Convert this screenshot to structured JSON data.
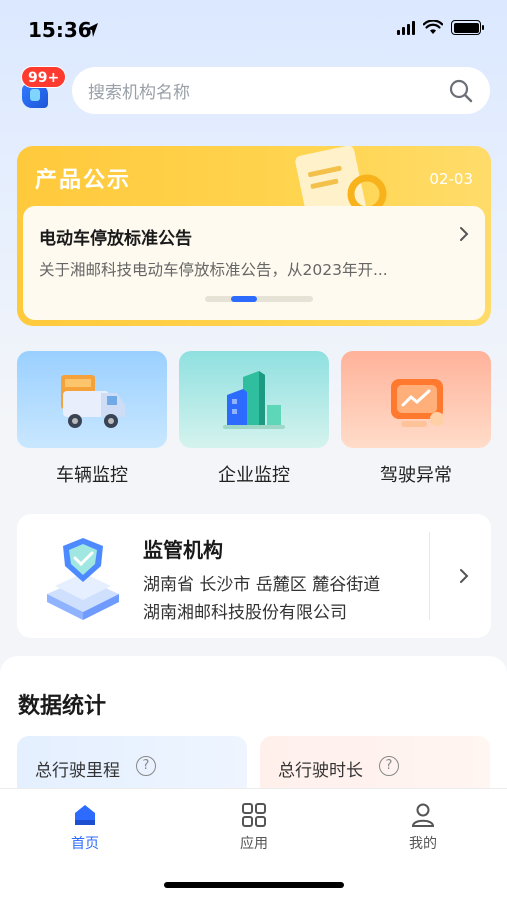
{
  "status_bar": {
    "time": "15:36"
  },
  "header": {
    "badge": "99+",
    "search_placeholder": "搜索机构名称"
  },
  "notice": {
    "title": "产品公示",
    "date": "02-03",
    "item_title": "电动车停放标准公告",
    "item_desc": "关于湘邮科技电动车停放标准公告，从2023年开..."
  },
  "tiles": [
    {
      "label": "车辆监控",
      "icon": "truck-icon"
    },
    {
      "label": "企业监控",
      "icon": "building-icon"
    },
    {
      "label": "驾驶异常",
      "icon": "warning-chart-icon"
    }
  ],
  "supervision": {
    "title": "监管机构",
    "address": "湖南省 长沙市 岳麓区 麓谷街道",
    "company": "湖南湘邮科技股份有限公司"
  },
  "stats": {
    "title": "数据统计",
    "cards": [
      {
        "label": "总行驶里程",
        "help": "?"
      },
      {
        "label": "总行驶时长",
        "help": "?"
      }
    ]
  },
  "tabbar": [
    {
      "label": "首页",
      "active": true
    },
    {
      "label": "应用",
      "active": false
    },
    {
      "label": "我的",
      "active": false
    }
  ],
  "colors": {
    "accent": "#2d6bff",
    "notice_bg": "#ffc93c",
    "badge": "#ff3b30"
  }
}
